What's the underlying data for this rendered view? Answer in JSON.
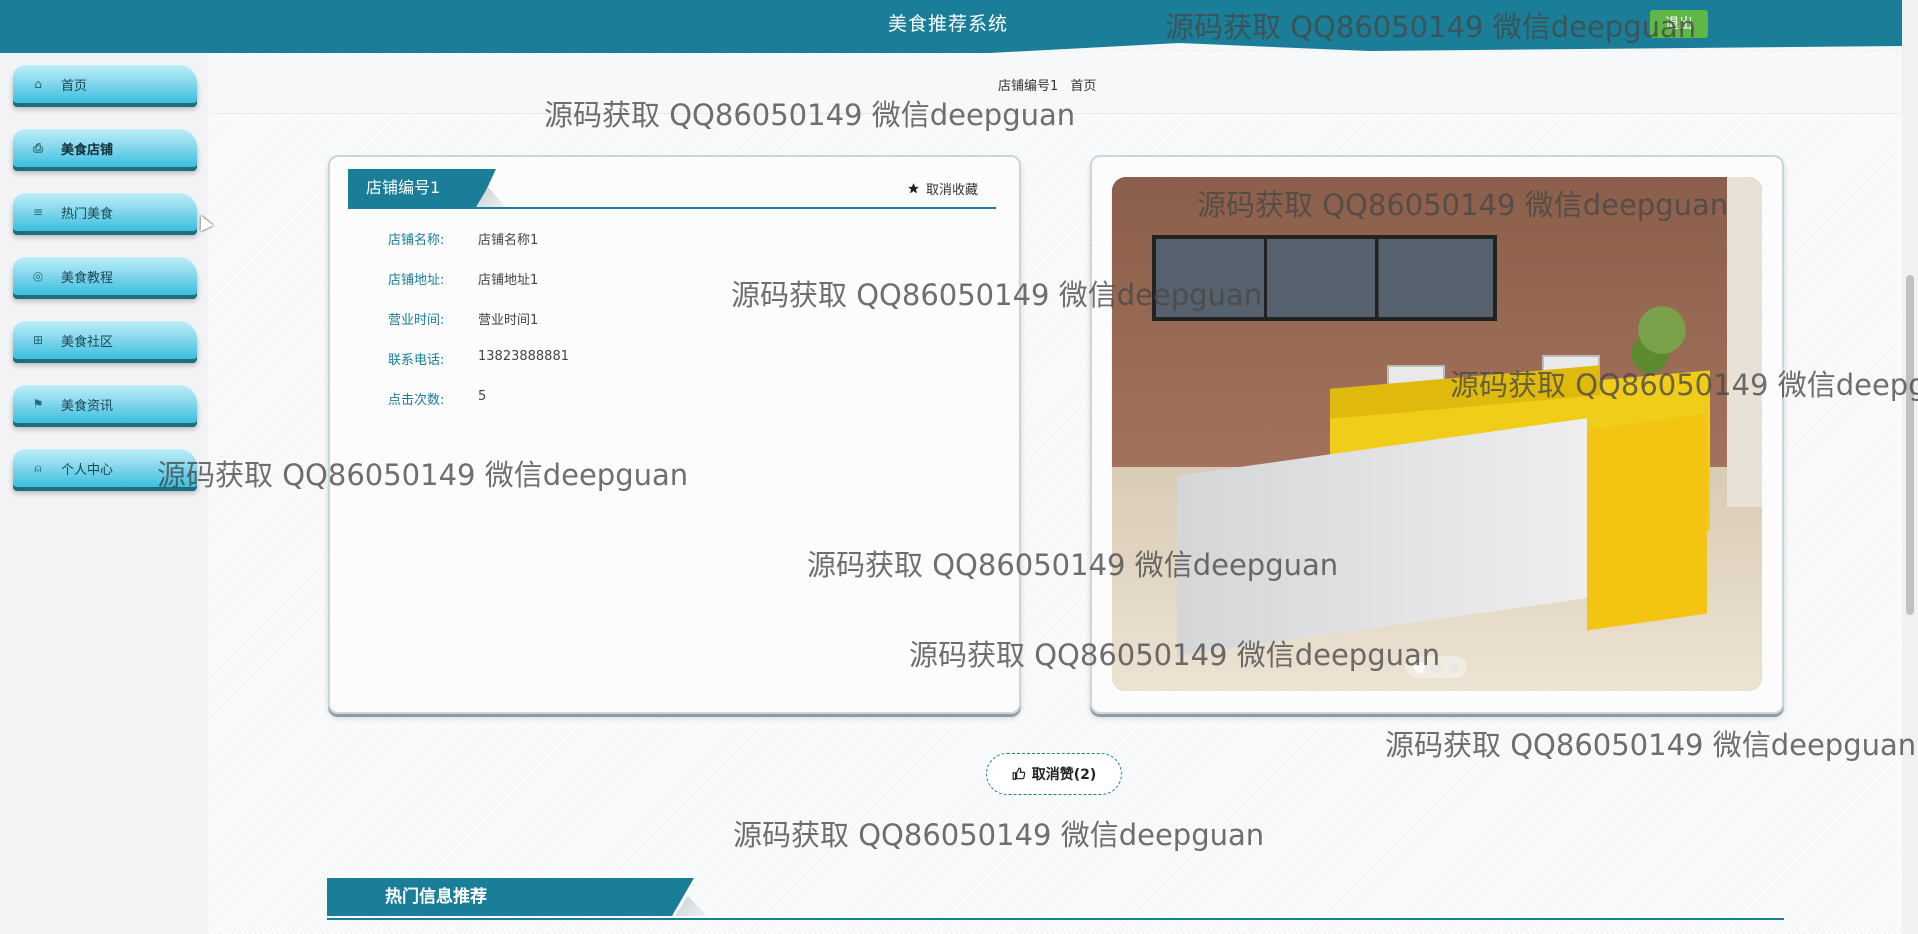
{
  "header": {
    "site_title": "美食推荐系统",
    "user_badge": "退出"
  },
  "sidebar": {
    "items": [
      {
        "label": "首页",
        "icon": "home-icon",
        "glyph": "⌂",
        "active": false
      },
      {
        "label": "美食店铺",
        "icon": "store-icon",
        "glyph": "⎙",
        "active": true
      },
      {
        "label": "热门美食",
        "icon": "sliders-icon",
        "glyph": "≡",
        "active": false
      },
      {
        "label": "美食教程",
        "icon": "tutorial-icon",
        "glyph": "◎",
        "active": false
      },
      {
        "label": "美食社区",
        "icon": "community-icon",
        "glyph": "⊞",
        "active": false
      },
      {
        "label": "美食资讯",
        "icon": "flag-icon",
        "glyph": "⚑",
        "active": false
      },
      {
        "label": "个人中心",
        "icon": "user-icon",
        "glyph": "⍝",
        "active": false
      }
    ]
  },
  "breadcrumb": {
    "current": "店铺编号1",
    "home": "首页"
  },
  "detail": {
    "title": "店铺编号1",
    "favorite_label": "取消收藏",
    "favorite_icon": "star-icon",
    "fields": [
      {
        "label": "店铺名称:",
        "value": "店铺名称1"
      },
      {
        "label": "店铺地址:",
        "value": "店铺地址1"
      },
      {
        "label": "营业时间:",
        "value": "营业时间1"
      },
      {
        "label": "联系电话:",
        "value": "13823888881"
      },
      {
        "label": "点击次数:",
        "value": "5"
      }
    ]
  },
  "carousel": {
    "slide_count": 3,
    "active_index": 0
  },
  "like": {
    "label": "取消赞(2)",
    "icon": "thumbs-up-icon"
  },
  "recommend": {
    "title": "热门信息推荐"
  },
  "watermark": {
    "text": "源码获取 QQ86050149 微信deepguan"
  },
  "colors": {
    "primary": "#1a7e98",
    "nav_light": "#bfeef8",
    "nav_dark": "#3cbfe0",
    "badge": "#5fb846"
  }
}
